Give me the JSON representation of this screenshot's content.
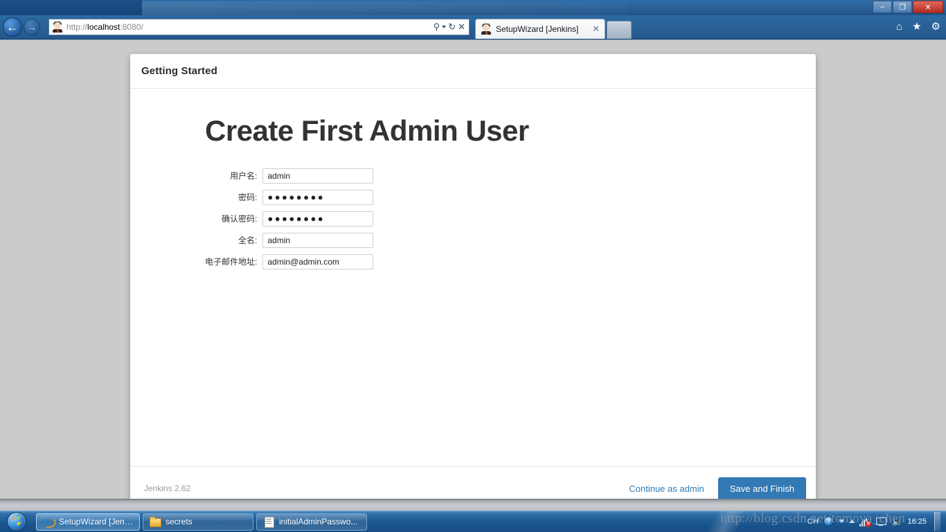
{
  "browser": {
    "window_controls": {
      "minimize": "–",
      "restore": "❐",
      "close": "✕"
    },
    "back_icon": "←",
    "forward_icon": "→",
    "address": {
      "scheme": "http://",
      "host": "localhost",
      "port": ":8080/",
      "full": "http://localhost:8080/"
    },
    "address_controls": {
      "search": "⚲",
      "refresh": "↻",
      "stop": "✕"
    },
    "tab": {
      "title": "SetupWizard [Jenkins]",
      "close": "✕"
    },
    "command_icons": {
      "home": "⌂",
      "favorites": "★",
      "settings": "⚙"
    }
  },
  "wizard": {
    "header_title": "Getting Started",
    "page_title": "Create First Admin User",
    "fields": [
      {
        "label": "用户名:",
        "name": "username",
        "type": "text",
        "value": "admin"
      },
      {
        "label": "密码:",
        "name": "password",
        "type": "password",
        "value": "●●●●●●●●"
      },
      {
        "label": "确认密码:",
        "name": "confirm-password",
        "type": "password",
        "value": "●●●●●●●●"
      },
      {
        "label": "全名:",
        "name": "fullname",
        "type": "text",
        "value": "admin"
      },
      {
        "label": "电子邮件地址:",
        "name": "email",
        "type": "text",
        "value": "admin@admin.com"
      }
    ],
    "footer": {
      "version": "Jenkins 2.62",
      "continue_link": "Continue as admin",
      "save_button": "Save and Finish"
    },
    "accent_color": "#3379b5",
    "link_color": "#2f7cb6"
  },
  "taskbar": {
    "start_label": "Start",
    "items": [
      {
        "label": "SetupWizard [Jenki...",
        "icon": "ie-icon",
        "active": true
      },
      {
        "label": "secrets",
        "icon": "folder-icon",
        "active": false
      },
      {
        "label": "initialAdminPasswo...",
        "icon": "notepad-icon",
        "active": false
      }
    ],
    "tray": {
      "ime": "CH",
      "help": "?",
      "clock": "16:25"
    }
  },
  "watermark": "http://blog.csdn.net/tomoya_chen"
}
